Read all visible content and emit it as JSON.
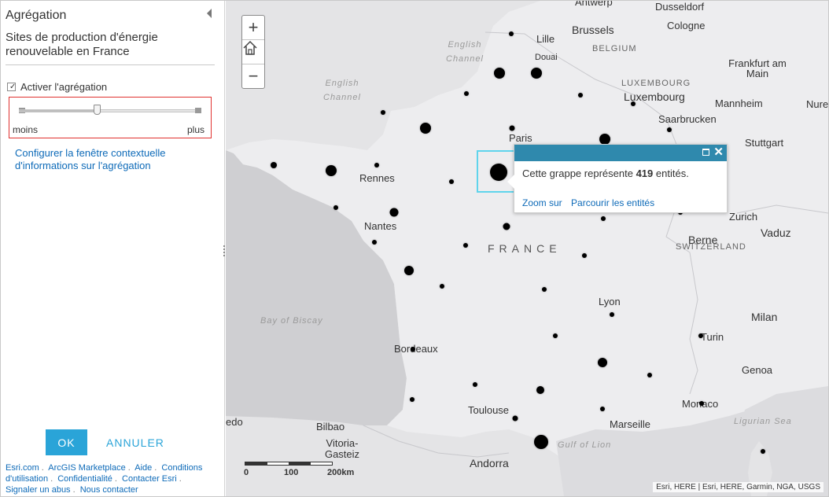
{
  "panel": {
    "title": "Agrégation",
    "subtitle": "Sites de production d'énergie renouvelable en France",
    "enable_label": "Activer l'agrégation",
    "enable_checked": true,
    "slider": {
      "min_label": "moins",
      "max_label": "plus",
      "level": 0.43
    },
    "config_link": "Configurer la fenêtre contextuelle d'informations sur l'agrégation",
    "ok_label": "OK",
    "cancel_label": "ANNULER",
    "footer_links": [
      "Esri.com",
      "ArcGIS Marketplace",
      "Aide",
      "Conditions d'utilisation",
      "Confidentialité",
      "Contacter Esri",
      "Signaler un abus",
      "Nous contacter"
    ]
  },
  "map": {
    "zoom_in": "+",
    "zoom_out": "−",
    "labels": {
      "antwerp": "Antwerp",
      "dusseldorf": "Dusseldorf",
      "lille": "Lille",
      "brussels": "Brussels",
      "cologne": "Cologne",
      "douai": "Douai",
      "belgium": "BELGIUM",
      "frankfurt": "Frankfurt am Main",
      "luxembourg_country": "LUXEMBOURG",
      "luxembourg": "Luxembourg",
      "mannheim": "Mannheim",
      "nure": "Nure",
      "saarbrucken": "Saarbrucken",
      "paris": "Paris",
      "stuttgart": "Stuttgart",
      "rennes": "Rennes",
      "zurich": "Zurich",
      "vaduz": "Vaduz",
      "nantes": "Nantes",
      "berne": "Berne",
      "switzerland": "SWITZERLAND",
      "france": "FRANCE",
      "lyon": "Lyon",
      "milan": "Milan",
      "turin": "Turin",
      "bordeaux": "Bordeaux",
      "genoa": "Genoa",
      "monaco": "Monaco",
      "toulouse": "Toulouse",
      "marseille": "Marseille",
      "edo": "edo",
      "bilbao": "Bilbao",
      "vitoria": "Vitoria-Gasteiz",
      "andorra": "Andorra",
      "english_channel_1": "English Channel",
      "english_channel_2": "English Channel",
      "bay_of_biscay": "Bay of Biscay",
      "gulf_of_lion": "Gulf of Lion",
      "ligurian_sea": "Ligurian Sea"
    },
    "scalebar": {
      "labels": [
        "0",
        "100",
        "200km"
      ]
    },
    "attribution": "Esri, HERE | Esri, HERE, Garmin, NGA, USGS"
  },
  "popup": {
    "text_before": "Cette grappe représente",
    "count": "419",
    "text_after": "entités.",
    "zoom_link": "Zoom sur",
    "browse_link": "Parcourir les entités"
  }
}
